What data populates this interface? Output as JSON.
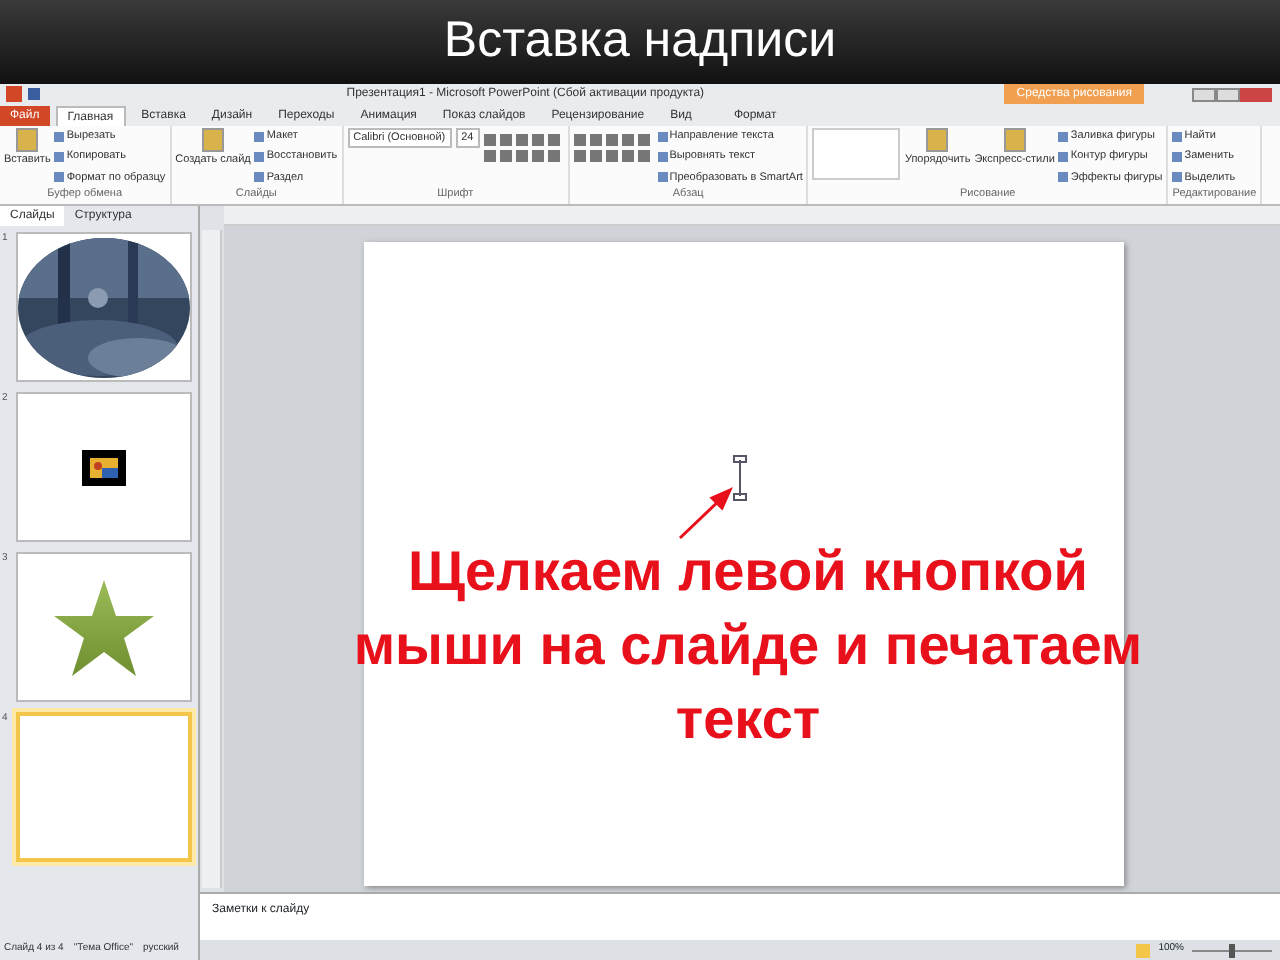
{
  "slide_title": "Вставка надписи",
  "window": {
    "title": "Презентация1 - Microsoft PowerPoint (Сбой активации продукта)",
    "context_tab": "Средства рисования"
  },
  "ribbon_tabs": [
    {
      "label": "Файл",
      "kind": "file",
      "selected": false
    },
    {
      "label": "Главная",
      "kind": "tab",
      "selected": true
    },
    {
      "label": "Вставка",
      "kind": "tab",
      "selected": false
    },
    {
      "label": "Дизайн",
      "kind": "tab",
      "selected": false
    },
    {
      "label": "Переходы",
      "kind": "tab",
      "selected": false
    },
    {
      "label": "Анимация",
      "kind": "tab",
      "selected": false
    },
    {
      "label": "Показ слайдов",
      "kind": "tab",
      "selected": false
    },
    {
      "label": "Рецензирование",
      "kind": "tab",
      "selected": false
    },
    {
      "label": "Вид",
      "kind": "tab",
      "selected": false
    },
    {
      "label": "Формат",
      "kind": "context",
      "selected": false
    }
  ],
  "ribbon_groups": [
    {
      "label": "Буфер обмена",
      "items": [
        {
          "kind": "big",
          "label": "Вставить"
        },
        {
          "kind": "small",
          "label": "Вырезать"
        },
        {
          "kind": "small",
          "label": "Копировать"
        },
        {
          "kind": "small",
          "label": "Формат по образцу"
        }
      ]
    },
    {
      "label": "Слайды",
      "items": [
        {
          "kind": "big",
          "label": "Создать слайд"
        },
        {
          "kind": "small",
          "label": "Макет"
        },
        {
          "kind": "small",
          "label": "Восстановить"
        },
        {
          "kind": "small",
          "label": "Раздел"
        }
      ]
    },
    {
      "label": "Шрифт",
      "items": [
        {
          "kind": "combo",
          "label": "Calibri (Основной)"
        },
        {
          "kind": "combo",
          "label": "24"
        },
        {
          "kind": "tools"
        }
      ]
    },
    {
      "label": "Абзац",
      "items": [
        {
          "kind": "tools"
        },
        {
          "kind": "small",
          "label": "Направление текста"
        },
        {
          "kind": "small",
          "label": "Выровнять текст"
        },
        {
          "kind": "small",
          "label": "Преобразовать в SmartArt"
        }
      ]
    },
    {
      "label": "Рисование",
      "items": [
        {
          "kind": "gallery"
        },
        {
          "kind": "big",
          "label": "Упорядочить"
        },
        {
          "kind": "big",
          "label": "Экспресс-стили"
        },
        {
          "kind": "small",
          "label": "Заливка фигуры"
        },
        {
          "kind": "small",
          "label": "Контур фигуры"
        },
        {
          "kind": "small",
          "label": "Эффекты фигуры"
        }
      ]
    },
    {
      "label": "Редактирование",
      "items": [
        {
          "kind": "small",
          "label": "Найти"
        },
        {
          "kind": "small",
          "label": "Заменить"
        },
        {
          "kind": "small",
          "label": "Выделить"
        }
      ]
    }
  ],
  "pane_tabs": [
    {
      "label": "Слайды",
      "selected": true
    },
    {
      "label": "Структура",
      "selected": false
    }
  ],
  "thumbnails": [
    {
      "number": "1",
      "selected": false
    },
    {
      "number": "2",
      "kind": "framed",
      "selected": false
    },
    {
      "number": "3",
      "kind": "star",
      "selected": false
    },
    {
      "number": "4",
      "kind": "blank",
      "selected": true
    }
  ],
  "caption": "Щелкаем левой кнопкой мыши на слайде и печатаем текст",
  "notes_placeholder": "Заметки к слайду",
  "status_bar": {
    "slide": "Слайд 4 из 4",
    "theme": "\"Тема Office\"",
    "language": "русский",
    "zoom": "100%",
    "zoom_slider": {
      "level": 0.5
    }
  }
}
